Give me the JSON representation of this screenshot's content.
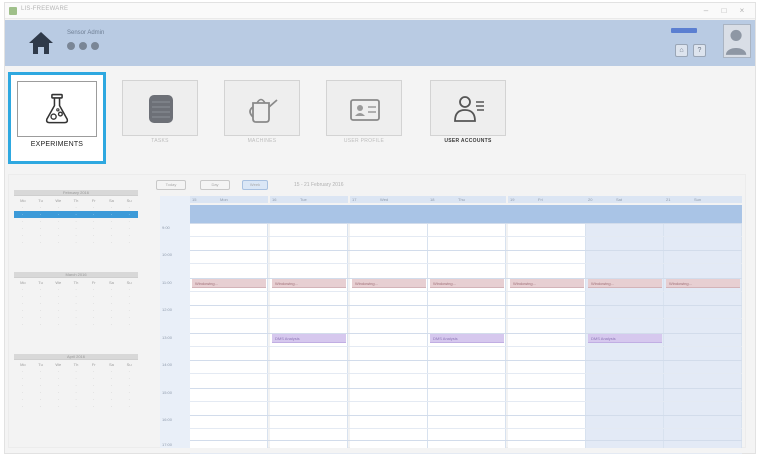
{
  "window": {
    "title": "LIS-FREEWARE",
    "controls": {
      "minimize": "–",
      "maximize": "□",
      "close": "×"
    }
  },
  "header": {
    "app_name": "Sensor Admin",
    "dot_icons": [
      "user-icon",
      "gear-icon",
      "power-icon"
    ],
    "user_link": "",
    "buttons": [
      "lock-icon",
      "help-icon"
    ]
  },
  "modules": [
    {
      "label": "EXPERIMENTS",
      "icon": "flask-icon",
      "selected": true
    },
    {
      "label": "TASKS",
      "icon": "server-icon",
      "selected": false
    },
    {
      "label": "MACHINES",
      "icon": "watering-can-icon",
      "selected": false
    },
    {
      "label": "USER PROFILE",
      "icon": "id-card-icon",
      "selected": false
    },
    {
      "label": "USER ACCOUNTS",
      "icon": "user-list-icon",
      "selected": false
    }
  ],
  "mini_calendars": [
    {
      "title": "February 2016",
      "highlight_row": 1
    },
    {
      "title": "March 2016",
      "highlight_row": -1
    },
    {
      "title": "April 2016",
      "highlight_row": -1
    }
  ],
  "weekday_short": [
    "Mo",
    "Tu",
    "We",
    "Th",
    "Fr",
    "Sa",
    "Su"
  ],
  "scheduler": {
    "toolbar": {
      "today": "Today",
      "day": "Day",
      "week": "Week"
    },
    "date_range": "15 - 21 February 2016",
    "days": [
      {
        "num": "15",
        "name": "Mon"
      },
      {
        "num": "16",
        "name": "Tue"
      },
      {
        "num": "17",
        "name": "Wed"
      },
      {
        "num": "18",
        "name": "Thu"
      },
      {
        "num": "19",
        "name": "Fri"
      },
      {
        "num": "20",
        "name": "Sat"
      },
      {
        "num": "21",
        "name": "Sun"
      }
    ],
    "hours": [
      "9:00",
      "10:00",
      "11:00",
      "12:00",
      "13:00",
      "14:00",
      "15:00",
      "16:00",
      "17:00"
    ],
    "appointments": [
      {
        "day": 0,
        "slot": 2,
        "text": "Windowing...",
        "color": "red"
      },
      {
        "day": 1,
        "slot": 2,
        "text": "Windowing...",
        "color": "red"
      },
      {
        "day": 2,
        "slot": 2,
        "text": "Windowing...",
        "color": "red"
      },
      {
        "day": 3,
        "slot": 2,
        "text": "Windowing...",
        "color": "red"
      },
      {
        "day": 4,
        "slot": 2,
        "text": "Windowing...",
        "color": "red"
      },
      {
        "day": 5,
        "slot": 2,
        "text": "Windowing...",
        "color": "red"
      },
      {
        "day": 6,
        "slot": 2,
        "text": "Windowing...",
        "color": "red"
      },
      {
        "day": 1,
        "slot": 4,
        "text": "DMS Analysis",
        "color": "purple"
      },
      {
        "day": 3,
        "slot": 4,
        "text": "DMS Analysis",
        "color": "purple"
      },
      {
        "day": 5,
        "slot": 4,
        "text": "DMS Analysis",
        "color": "purple"
      }
    ]
  },
  "colors": {
    "header": "#b9cbe3",
    "selection_frame": "#2ea8e0",
    "calendar_band": "#a9c4e6",
    "weekend": "#e3eaf6"
  }
}
